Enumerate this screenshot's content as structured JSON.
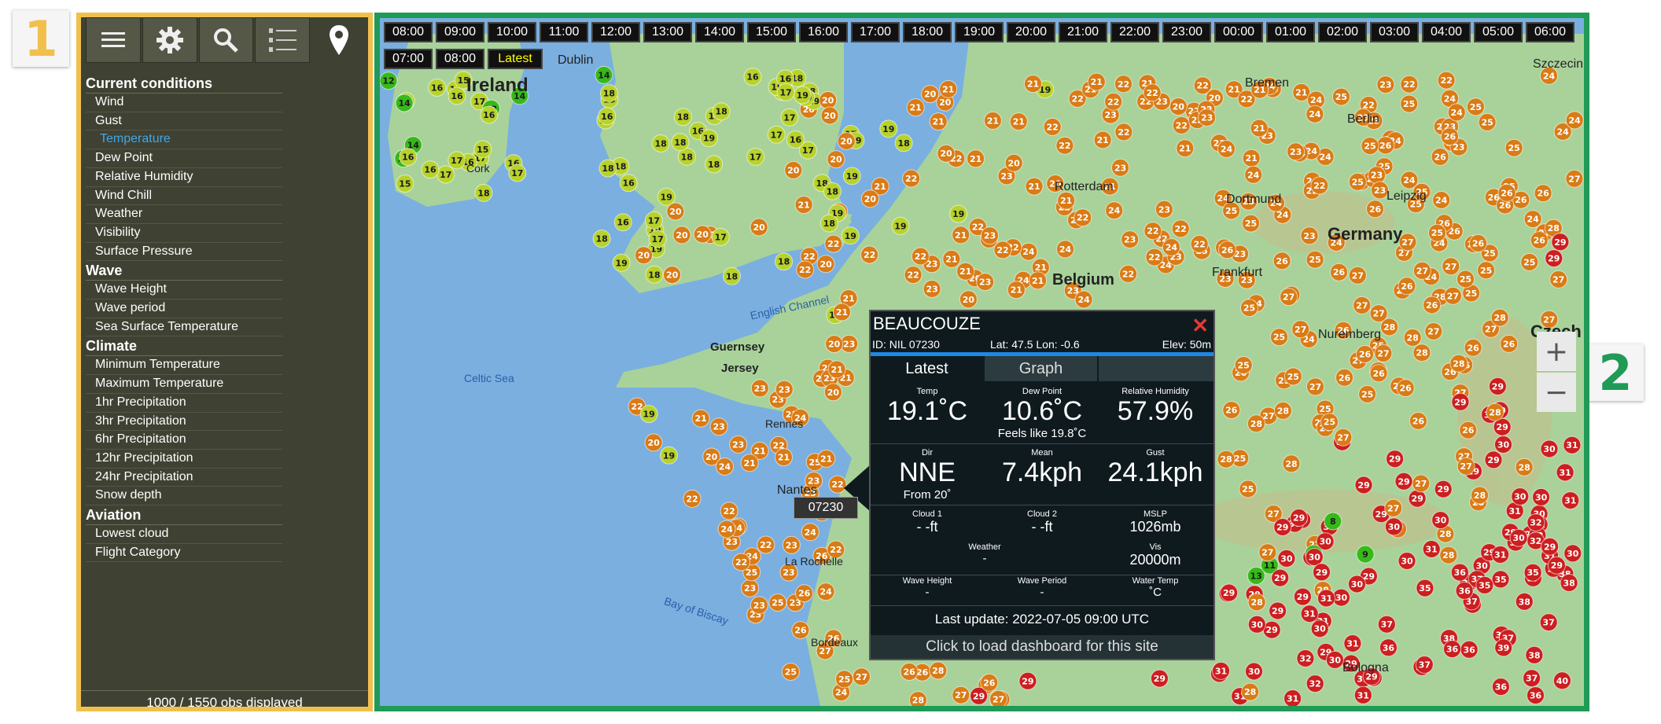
{
  "annotations": {
    "badge_1": "1",
    "badge_2": "2"
  },
  "toolbar": {
    "icons": [
      "menu-icon",
      "gear-icon",
      "search-icon",
      "list-icon",
      "location-pin-icon"
    ]
  },
  "sidebar": {
    "sections": [
      {
        "title": "Current conditions",
        "items": [
          "Wind",
          "Gust",
          "Temperature",
          "Dew Point",
          "Relative Humidity",
          "Wind Chill",
          "Weather",
          "Visibility",
          "Surface Pressure"
        ],
        "selected": "Temperature"
      },
      {
        "title": "Wave",
        "items": [
          "Wave Height",
          "Wave period",
          "Sea Surface Temperature"
        ]
      },
      {
        "title": "Climate",
        "items": [
          "Minimum Temperature",
          "Maximum Temperature",
          "1hr Precipitation",
          "3hr Precipitation",
          "6hr Precipitation",
          "12hr Precipitation",
          "24hr Precipitation",
          "Snow depth"
        ]
      },
      {
        "title": "Aviation",
        "items": [
          "Lowest cloud",
          "Flight Category"
        ]
      }
    ],
    "obs_count": "1000 / 1550 obs displayed"
  },
  "timebar": {
    "row1": [
      "08:00",
      "09:00",
      "10:00",
      "11:00",
      "12:00",
      "13:00",
      "14:00",
      "15:00",
      "16:00",
      "17:00",
      "18:00",
      "19:00",
      "20:00",
      "21:00",
      "22:00",
      "23:00",
      "00:00",
      "01:00",
      "02:00",
      "03:00",
      "04:00",
      "05:00",
      "06:00"
    ],
    "row2": [
      "07:00",
      "08:00",
      "Latest"
    ]
  },
  "map": {
    "zoom_in": "+",
    "zoom_out": "−",
    "places": [
      "Dublin",
      "Ireland",
      "Cork",
      "Bremen",
      "Rotterdam",
      "Dortmund",
      "Berlin",
      "Leipzig",
      "Germany",
      "Frankfurt",
      "Belgium",
      "Nuremberg",
      "Rennes",
      "Nantes",
      "La Rochelle",
      "Bordeaux",
      "Guernsey",
      "Jersey",
      "Szczecin",
      "Czech",
      "Bologna"
    ],
    "seas": [
      "Celtic Sea",
      "English Channel",
      "Bay of Biscay"
    ],
    "station_tag": "07230",
    "colors": {
      "green": "#37b91a",
      "yellowgreen": "#b8d22c",
      "orange": "#d97b16",
      "red": "#cc1f1f",
      "land": "#a8d29a",
      "sea": "#7aafe0"
    }
  },
  "popup": {
    "name": "BEAUCOUZE",
    "id": "ID: NIL 07230",
    "latlon": "Lat: 47.5 Lon: -0.6",
    "elev": "Elev: 50m",
    "tabs": [
      "Latest",
      "Graph"
    ],
    "temp_label": "Temp",
    "temp": "19.1˚C",
    "dew_label": "Dew Point",
    "dew": "10.6˚C",
    "rh_label": "Relative Humidity",
    "rh": "57.9%",
    "feels": "Feels like 19.8˚C",
    "dir_label": "Dir",
    "dir": "NNE",
    "dir_from": "From 20˚",
    "mean_label": "Mean",
    "mean": "7.4kph",
    "gust_label": "Gust",
    "gust": "24.1kph",
    "cloud1_label": "Cloud 1",
    "cloud1": "- -ft",
    "cloud2_label": "Cloud 2",
    "cloud2": "- -ft",
    "mslp_label": "MSLP",
    "mslp": "1026mb",
    "weather_label": "Weather",
    "weather": "-",
    "vis_label": "Vis",
    "vis": "20000m",
    "wave_h_label": "Wave Height",
    "wave_h": "-",
    "wave_p_label": "Wave Period",
    "wave_p": "-",
    "water_label": "Water Temp",
    "water": "˚C",
    "last_update": "Last update: 2022-07-05 09:00 UTC",
    "dashboard": "Click to load dashboard for this site",
    "close": "✕"
  }
}
